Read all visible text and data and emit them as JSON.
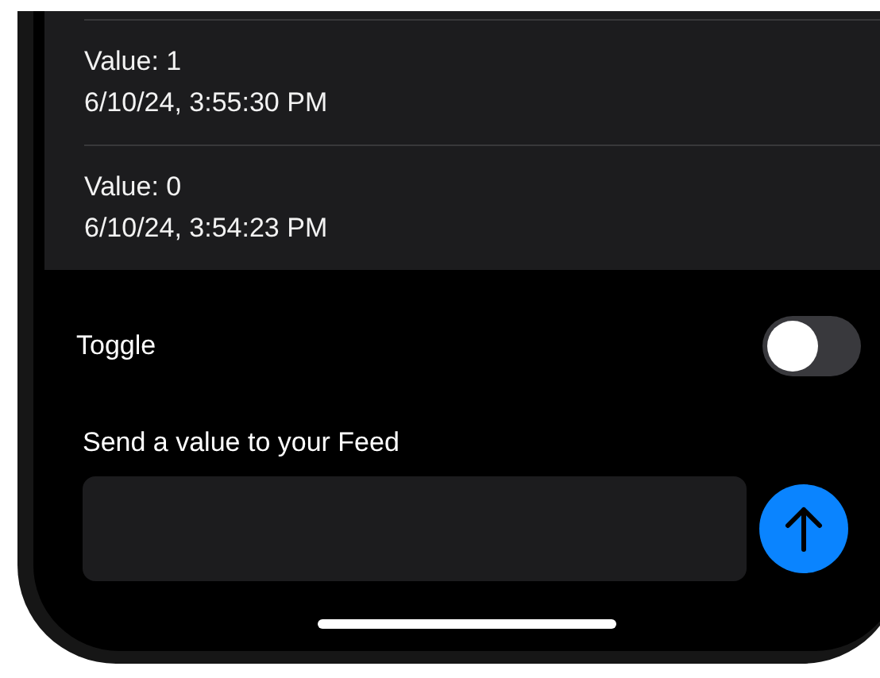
{
  "readings": [
    {
      "value": "Value: 1",
      "timestamp": "6/10/24, 3:55:30 PM"
    },
    {
      "value": "Value: 0",
      "timestamp": "6/10/24, 3:54:23 PM"
    }
  ],
  "toggle": {
    "label": "Toggle",
    "on": false
  },
  "send": {
    "label": "Send a value to your Feed"
  }
}
